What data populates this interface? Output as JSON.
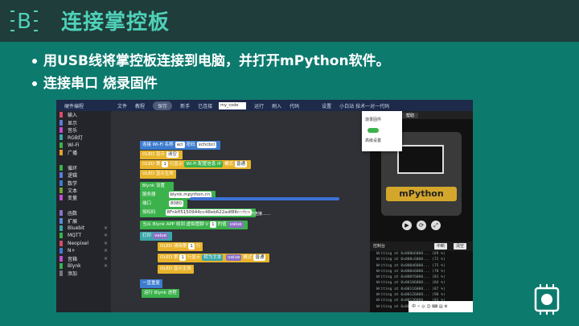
{
  "header": {
    "logo_letter": "B",
    "title": "连接掌控板"
  },
  "bullets": [
    "用USB线将掌控板连接到电脑，并打开mPython软件。",
    "连接串口  烧录固件"
  ],
  "menubar": {
    "items": [
      "硬件编程",
      "文件",
      "教程",
      "保存",
      "新手",
      "已连接",
      "运行",
      "刷入",
      "代码",
      "设置",
      "小白站 技术一对一代码"
    ],
    "active": "保存",
    "code_field": "my_code"
  },
  "sidebar": {
    "items": [
      {
        "label": "输入",
        "color": "#d94b6b"
      },
      {
        "label": "显示",
        "color": "#5b7dd8"
      },
      {
        "label": "音乐",
        "color": "#c24fcf"
      },
      {
        "label": "RGB灯",
        "color": "#3aa6a9"
      },
      {
        "label": "Wi-Fi",
        "color": "#3bb24b"
      },
      {
        "label": "广播",
        "color": "#e0a030"
      },
      {
        "label": "",
        "color": "#23252b"
      },
      {
        "label": "循环",
        "color": "#3bb24b"
      },
      {
        "label": "逻辑",
        "color": "#5b7dd8"
      },
      {
        "label": "数学",
        "color": "#3d7ccf"
      },
      {
        "label": "文本",
        "color": "#6fa830"
      },
      {
        "label": "变量",
        "color": "#c24fcf"
      },
      {
        "label": "",
        "color": "#23252b"
      },
      {
        "label": "函数",
        "color": "#8d6fc7"
      },
      {
        "label": "扩展",
        "color": "#5a8bd6"
      },
      {
        "label": "Bluebit",
        "color": "#3aa6a9"
      },
      {
        "label": "MQTT",
        "color": "#3bb24b"
      },
      {
        "label": "Neopixel",
        "color": "#d94b6b"
      },
      {
        "label": "N+",
        "color": "#3d7ccf"
      },
      {
        "label": "音箱",
        "color": "#c24fcf"
      },
      {
        "label": "Blynk",
        "color": "#3bb24b"
      },
      {
        "label": "添加",
        "color": "#777"
      }
    ]
  },
  "blocks": {
    "wifi_connect": {
      "label": "连接 Wi-Fi 名称",
      "ssid": "acl",
      "pwd_label": "密码",
      "pwd": "xchcbcl"
    },
    "oled_clear": {
      "label": "OLED 显示",
      "val": "清空"
    },
    "oled_text": {
      "a": "OLED 第",
      "line": "1",
      "b": "行显示",
      "c": "Wi-Fi 配置信息",
      "d": "IP",
      "e": "模式",
      "f": "普通"
    },
    "oled_show": "OLED 显示生效",
    "blynk_set": "Blynk 设置",
    "server": {
      "label": "服务器",
      "val": "blynk.mpython.cn"
    },
    "port": {
      "label": "端口",
      "val": "8080"
    },
    "token": {
      "label": "授权码",
      "val": "8Fnkfl5150944cc48eb622adf86ccdca"
    },
    "vpin": {
      "label": "当从 Blynk APP 收到 虚拟管脚 V",
      "n": "1",
      "c": "的值",
      "v": "value"
    },
    "print": {
      "label": "打印",
      "v": "value"
    },
    "oled_line": {
      "a": "OLED 清除第",
      "n": "1",
      "b": "行"
    },
    "oled_text2": {
      "a": "OLED 第",
      "n": "1",
      "b": "行显示",
      "c": "转为文本",
      "v": "value",
      "d": "模式",
      "e": "普通"
    },
    "oled_show2": "OLED 显示生效",
    "loop": "一直重复",
    "run_blynk": "运行 Blynk 进程",
    "tooltip": "循环断开连接……"
  },
  "dropdown": [
    "烧录固件",
    "",
    "高级设置"
  ],
  "hardware": {
    "tabs": [
      "硬件",
      "仿真",
      "帮助"
    ],
    "brand": "mPython",
    "controls": [
      "▶",
      "⟳",
      "⤢"
    ]
  },
  "console": {
    "title": "控制台",
    "btn1": "中断",
    "btn2": "清空",
    "lines": [
      "Writing at 0x000b6000... (69 %)",
      "Writing at 0x000c6000... (72 %)",
      "Writing at 0x000d6000... (75 %)",
      "Writing at 0x000e6000... (78 %)",
      "Writing at 0x000f6000... (81 %)",
      "Writing at 0x00106000... (84 %)",
      "Writing at 0x00116000... (87 %)",
      "Writing at 0x00126000... (90 %)",
      "Writing at 0x00136000... (93 %)",
      "Writing at 0x00146000... (96 %)"
    ]
  },
  "tray": "中 ⚬ ◎ ☺ ⌨ ▤ ⚙",
  "colors": {
    "accent": "#4fd1b9",
    "bg": "#0d7a6e"
  }
}
